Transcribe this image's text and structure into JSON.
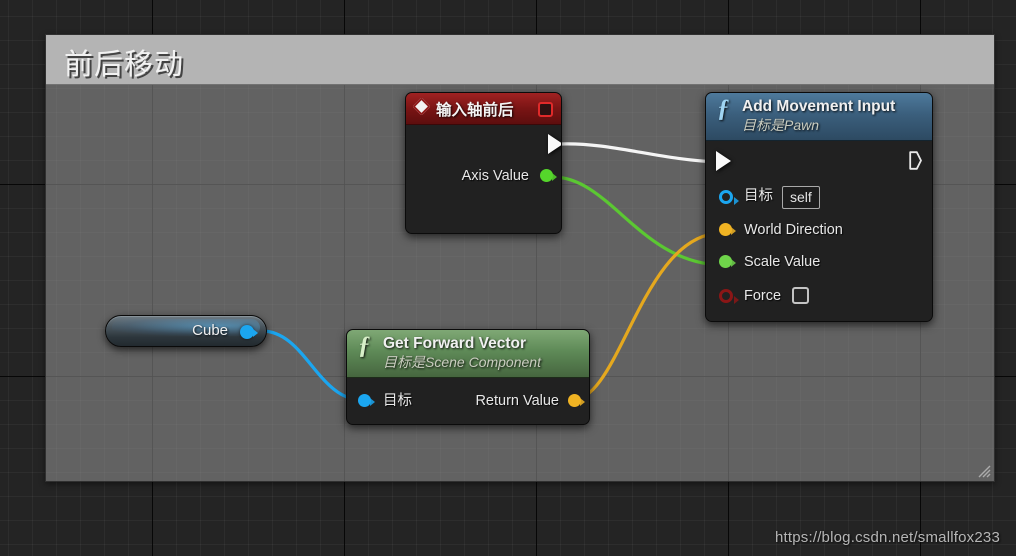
{
  "comment": {
    "title": "前后移动"
  },
  "watermark": "https://blog.csdn.net/smallfox233",
  "nodes": {
    "event": {
      "title": "输入轴前后",
      "exec_out_label": "",
      "pins": [
        {
          "label": "Axis Value",
          "color": "#55d62b"
        }
      ]
    },
    "add_movement_input": {
      "title": "Add Movement Input",
      "subtitle": "目标是Pawn",
      "pins": [
        {
          "label": "目标",
          "value": "self",
          "color": "#1ba6f0"
        },
        {
          "label": "World Direction",
          "color": "#f0b323"
        },
        {
          "label": "Scale Value",
          "color": "#6fd44a"
        },
        {
          "label": "Force",
          "value": "unchecked",
          "color": "#8a1616"
        }
      ]
    },
    "get_forward_vector": {
      "title": "Get Forward Vector",
      "subtitle": "目标是Scene Component",
      "input_label": "目标",
      "output_label": "Return Value"
    },
    "cube": {
      "label": "Cube"
    }
  },
  "wires": [
    {
      "name": "exec-wire",
      "from": "event.exec-out",
      "to": "add_movement_input.exec-in",
      "color": "#ffffff"
    },
    {
      "name": "axis-value-to-scale-value",
      "from": "event.Axis Value",
      "to": "add_movement_input.Scale Value",
      "color": "#5bc832"
    },
    {
      "name": "return-value-to-world-direction",
      "from": "get_forward_vector.Return Value",
      "to": "add_movement_input.World Direction",
      "color": "#e5a81e"
    },
    {
      "name": "cube-to-target",
      "from": "cube.out",
      "to": "get_forward_vector.目标",
      "color": "#1ba6f0"
    }
  ],
  "colors": {
    "exec": "#ffffff",
    "object": "#1ba6f0",
    "vector": "#f0b323",
    "float": "#6fd44a",
    "boolean": "#8a1616",
    "event_header": "#7a1414",
    "function_header": "#3b5f7d",
    "pure_function_header": "#5e8a57",
    "comment_header": "#b4b4b4"
  }
}
